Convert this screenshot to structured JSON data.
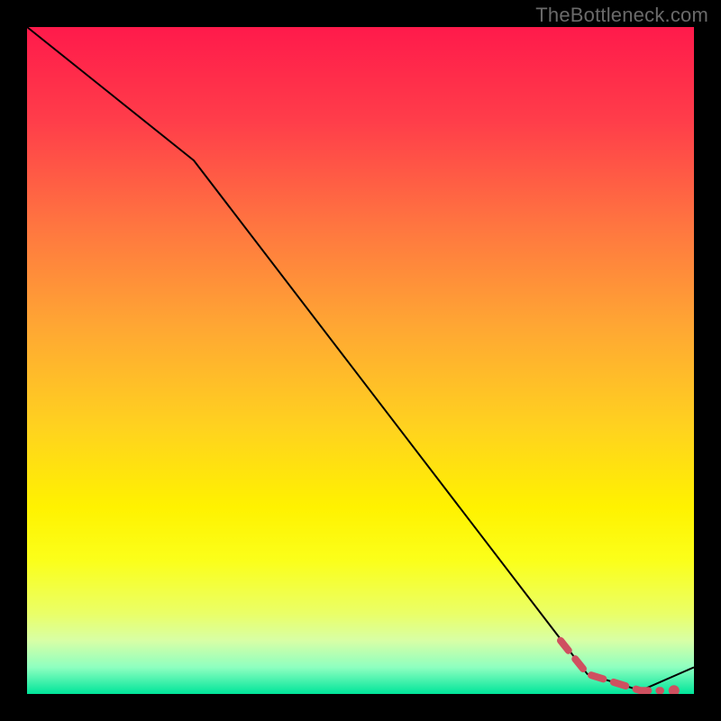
{
  "watermark": "TheBottleneck.com",
  "chart_data": {
    "type": "line",
    "title": "",
    "xlabel": "",
    "ylabel": "",
    "xlim": [
      0,
      100
    ],
    "ylim": [
      0,
      100
    ],
    "background": "rainbow-gradient",
    "series": [
      {
        "name": "bottleneck-curve",
        "x": [
          0,
          25,
          84,
          92,
          100
        ],
        "y": [
          100,
          80,
          3,
          0.5,
          4
        ],
        "style": "solid-black"
      },
      {
        "name": "optimal-range-marker",
        "x": [
          80,
          84,
          92,
          95
        ],
        "y": [
          8,
          3,
          0.5,
          0.5
        ],
        "style": "dashed-salmon"
      }
    ]
  },
  "gradient_stops": [
    {
      "offset": 0,
      "color": "#ff1a4b"
    },
    {
      "offset": 14,
      "color": "#ff3d4a"
    },
    {
      "offset": 30,
      "color": "#ff7640"
    },
    {
      "offset": 45,
      "color": "#ffa733"
    },
    {
      "offset": 60,
      "color": "#ffd21f"
    },
    {
      "offset": 72,
      "color": "#fff200"
    },
    {
      "offset": 80,
      "color": "#fbff1a"
    },
    {
      "offset": 88,
      "color": "#eaff68"
    },
    {
      "offset": 92,
      "color": "#d8ffa6"
    },
    {
      "offset": 96,
      "color": "#8effc0"
    },
    {
      "offset": 100,
      "color": "#00e59a"
    }
  ]
}
